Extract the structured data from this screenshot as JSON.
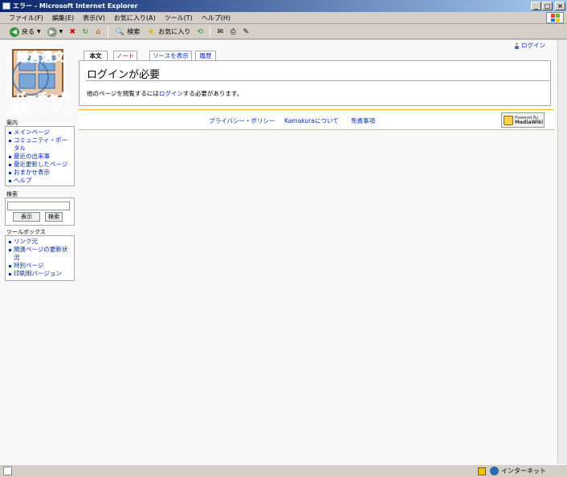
{
  "window": {
    "title": "エラー - Microsoft Internet Explorer"
  },
  "menu": [
    "ファイル(F)",
    "編集(E)",
    "表示(V)",
    "お気に入り(A)",
    "ツール(T)",
    "ヘルプ(H)"
  ],
  "toolbar": {
    "back": "戻る",
    "search": "検索",
    "favorites": "お気に入り"
  },
  "personal": {
    "login": "ログイン"
  },
  "tabs": {
    "main": "本文",
    "talk": "ノート",
    "source": "ソースを表示",
    "history": "履歴"
  },
  "logo": {
    "line1": "鎌倉遺文",
    "line2": "バーチャル",
    "line3": "研究システム"
  },
  "page": {
    "title": "ログインが必要",
    "msg_before": "他のページを閲覧するには",
    "msg_link": "ログイン",
    "msg_after": "する必要があります。"
  },
  "navigation": {
    "title": "案内",
    "items": [
      "メインページ",
      "コミュニティ・ポータル",
      "最近の出来事",
      "最近更新したページ",
      "おまかせ表示",
      "ヘルプ"
    ]
  },
  "search": {
    "title": "検索",
    "go": "表示",
    "search": "検索"
  },
  "toolbox": {
    "title": "ツールボックス",
    "items": [
      "リンク元",
      "関連ページの更新状況",
      "特別ページ",
      "印刷用バージョン"
    ]
  },
  "footer": {
    "privacy": "プライバシー・ポリシー",
    "about": "Kamakuraについて",
    "disclaimer": "免責事項"
  },
  "powered": {
    "line1": "Powered By",
    "line2": "MediaWiki"
  },
  "status": {
    "zone": "インターネット"
  },
  "colors": {
    "link": "#002bb8",
    "newlink": "#ba0000",
    "titlebar": "#0a246a",
    "footer_border": "#fabd23"
  }
}
